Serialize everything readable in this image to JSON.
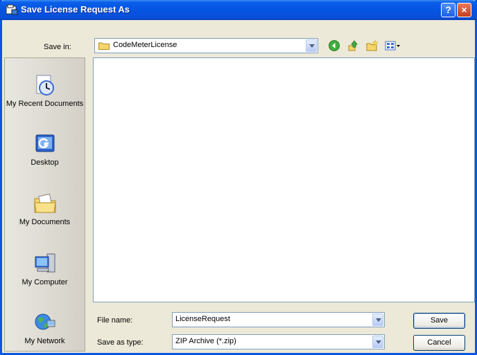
{
  "window": {
    "title": "Save License Request As",
    "help_icon": "?",
    "close_icon": "×"
  },
  "save_in": {
    "label": "Save in:",
    "folder": "CodeMeterLicense",
    "toolbar_icons": [
      "back-icon",
      "up-folder-icon",
      "new-folder-icon",
      "view-menu-icon"
    ]
  },
  "places": [
    {
      "label": "My Recent Documents",
      "icon": "recent-documents-icon"
    },
    {
      "label": "Desktop",
      "icon": "desktop-icon"
    },
    {
      "label": "My Documents",
      "icon": "my-documents-icon"
    },
    {
      "label": "My Computer",
      "icon": "my-computer-icon"
    },
    {
      "label": "My Network",
      "icon": "my-network-icon"
    }
  ],
  "file_name": {
    "label": "File name:",
    "value": "LicenseRequest"
  },
  "save_as_type": {
    "label": "Save as type:",
    "value": "ZIP Archive (*.zip)"
  },
  "buttons": {
    "save": "Save",
    "cancel": "Cancel"
  },
  "colors": {
    "titlebar": "#0554E3",
    "dialog_bg": "#ECE9D8",
    "field_border": "#7F9DB9",
    "button_border": "#003C74"
  }
}
